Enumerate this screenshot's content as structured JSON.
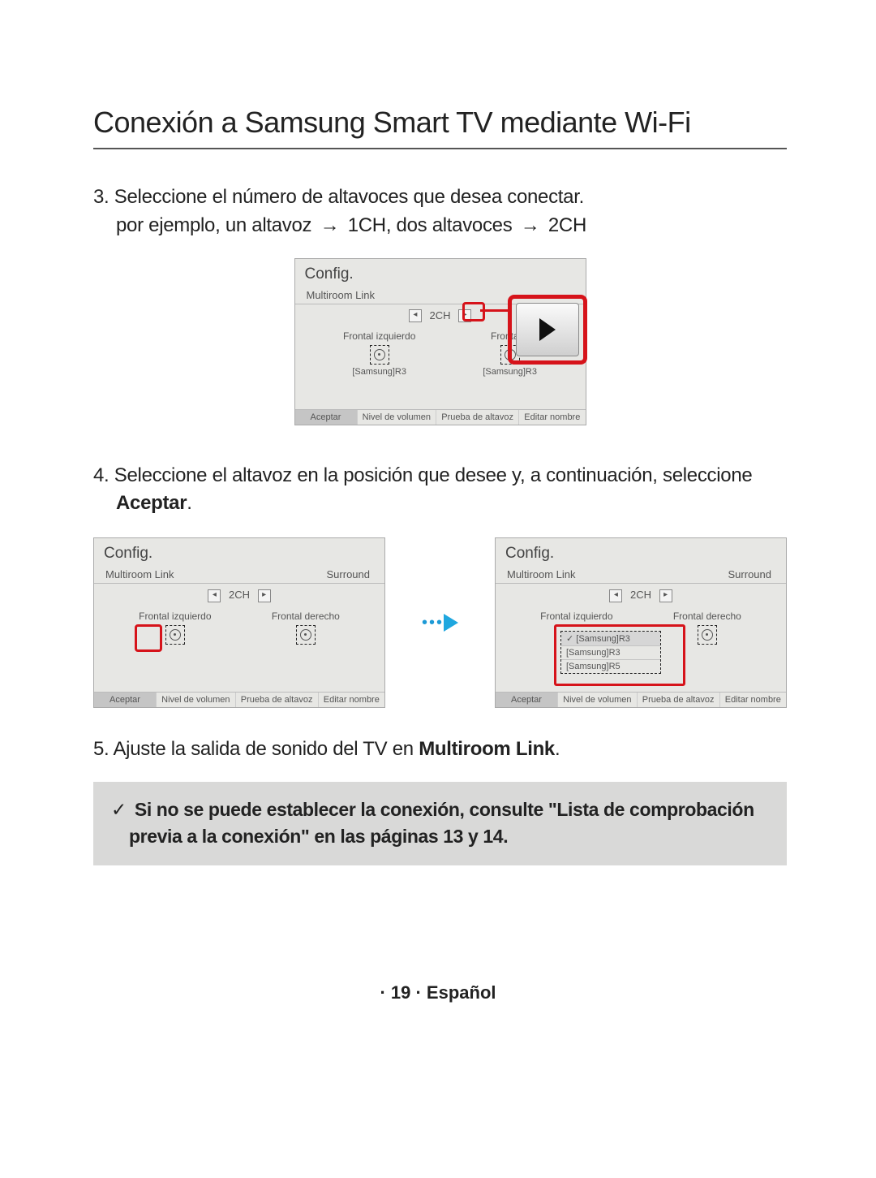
{
  "title": "Conexión a Samsung Smart TV mediante Wi-Fi",
  "step3": {
    "number": "3.",
    "lead": "Seleccione el número de altavoces que desea conectar.",
    "example_pre": "por ejemplo, un altavoz",
    "arrow": "→",
    "ch1": "1CH, dos altavoces",
    "ch2": "2CH"
  },
  "step4": {
    "number": "4.",
    "text_pre": "Seleccione el altavoz en la posición que desee y, a continuación, seleccione",
    "accept": "Aceptar",
    "dot": "."
  },
  "step5": {
    "number": "5.",
    "text_pre": "Ajuste la salida de sonido del TV en",
    "multiroom": "Multiroom Link",
    "dot": "."
  },
  "note": {
    "check": "✓",
    "text": "Si no se puede establecer la conexión, consulte \"Lista de comprobación previa a la conexión\" en las páginas 13 y 14."
  },
  "footer": "· 19 · Español",
  "ui": {
    "config": "Config.",
    "multiroom_link": "Multiroom Link",
    "surround": "Surround",
    "ch_value": "2CH",
    "left_arrow": "◂",
    "right_arrow": "▸",
    "frontal_izq": "Frontal izquierdo",
    "frontal_der": "Frontal derecho",
    "frontal_d_trunc": "Frontal d",
    "model_r3": "[Samsung]R3",
    "model_r5": "[Samsung]R5",
    "check_mark": "✓",
    "footer_bar": {
      "aceptar": "Aceptar",
      "nivel": "Nivel de volumen",
      "prueba": "Prueba de altavoz",
      "editar": "Editar nombre"
    }
  }
}
